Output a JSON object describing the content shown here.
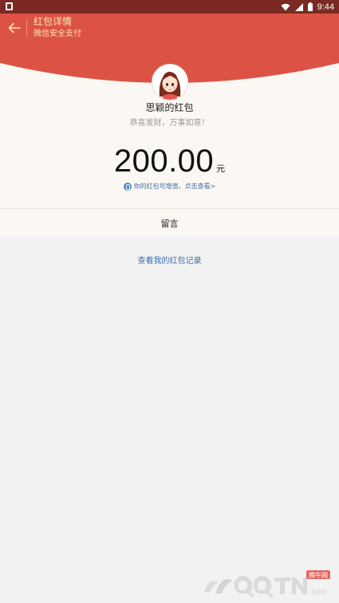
{
  "status_bar": {
    "time": "9:44"
  },
  "header": {
    "title": "红包详情",
    "subtitle": "微信安全支付",
    "back_icon": "arrow-left-icon"
  },
  "envelope": {
    "sender": "思颖的红包",
    "greeting": "恭喜发财，万事如意！",
    "amount": "200.00",
    "unit": "元",
    "promo_text": "你的红包可增值，点击查看>"
  },
  "message_section": {
    "label": "留言"
  },
  "footer_link": {
    "label": "查看我的红包记录"
  },
  "watermark": {
    "brand_small": "腾牛网",
    "brand_main": "QQTN",
    "suffix": ".com"
  },
  "colors": {
    "header_red": "#dc5345",
    "status_bar": "#7a2a23",
    "gold_text": "#ffe3b3",
    "link_blue": "#3d6fa8",
    "card_bg": "#fbf7f2",
    "page_bg": "#f2f2f2"
  }
}
